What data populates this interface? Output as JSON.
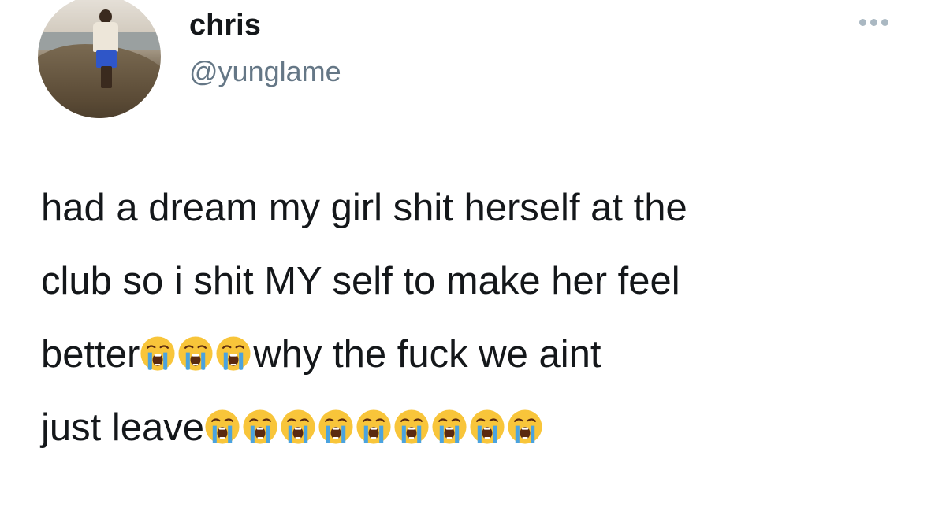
{
  "tweet": {
    "author": {
      "display_name": "chris",
      "handle": "@yunglame"
    },
    "more_icon": "more-options-icon",
    "text": {
      "line1": "had a dream my girl shit herself at the",
      "line2": "club so i shit MY self to make her feel",
      "line3_a": "better",
      "line3_b": "why the fuck we aint",
      "line4_a": "just leave"
    },
    "emoji": {
      "name": "loudly-crying-face",
      "count_line3": 3,
      "count_line4": 9,
      "colors": {
        "face": "#f8c53a",
        "tears": "#4aa3df",
        "mouth": "#5a2a10"
      }
    }
  }
}
